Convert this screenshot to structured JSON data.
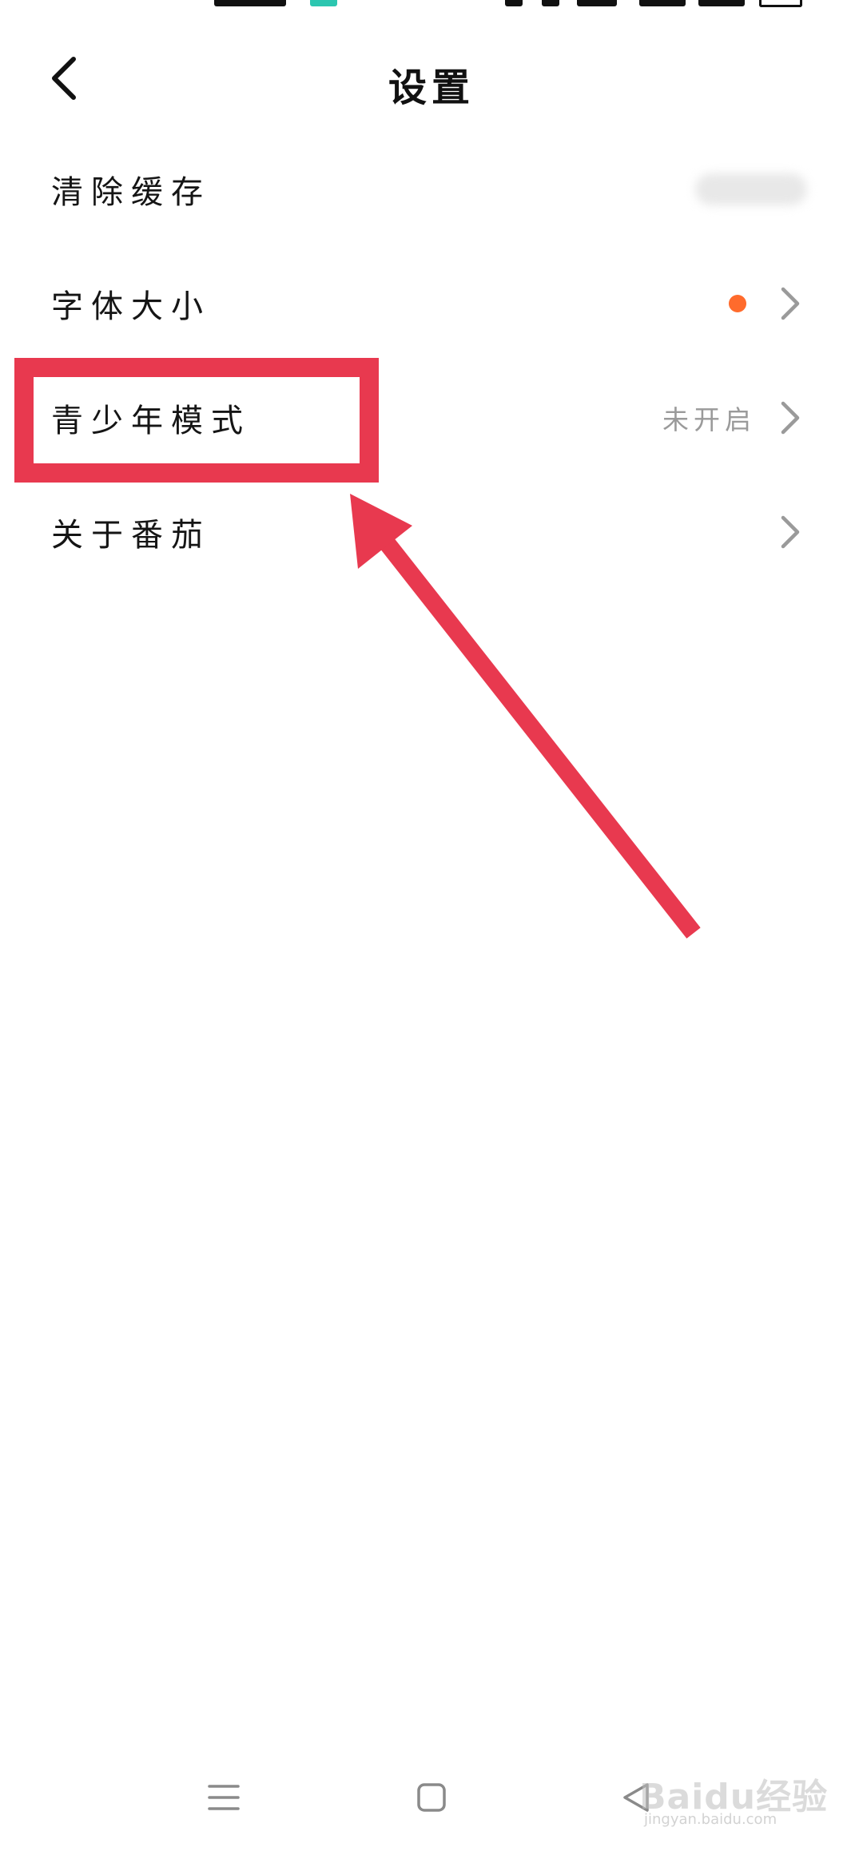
{
  "header": {
    "title": "设置",
    "back_icon": "chevron-left-icon"
  },
  "settings": {
    "items": [
      {
        "label": "清除缓存",
        "value": ""
      },
      {
        "label": "字体大小",
        "badge_color": "#ff6b2c"
      },
      {
        "label": "青少年模式",
        "value": "未开启"
      },
      {
        "label": "关于番茄"
      }
    ]
  },
  "annotation": {
    "highlight_color": "#e8394f",
    "highlighted_item": "青少年模式"
  },
  "nav": {
    "menu_icon": "menu-icon",
    "home_icon": "home-square-icon",
    "back_icon": "back-triangle-icon"
  },
  "watermark": {
    "text": "Baidu经验",
    "sub": "jingyan.baidu.com"
  }
}
